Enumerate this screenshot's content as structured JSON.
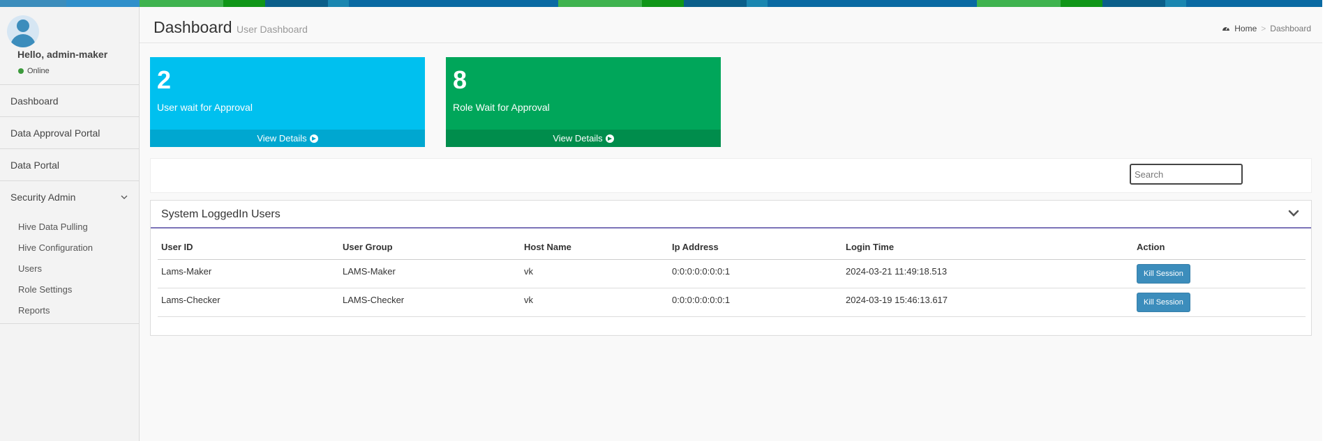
{
  "top_strip_colors": [
    "#3c8dbc",
    "#2f9ad0",
    "#3fb34f",
    "#109618",
    "#0b5f8a",
    "#1171a8",
    "#0b73a8",
    "#0a6aa3",
    "#3fb34f",
    "#109618",
    "#0b5f8a",
    "#1a86b0",
    "#0a6aa3",
    "#0b6aa3",
    "#3fb34f",
    "#109618",
    "#0b5f8a",
    "#1a86b0",
    "#0a6aa3"
  ],
  "user": {
    "greeting": "Hello, admin-maker",
    "status": "Online"
  },
  "sidebar": {
    "items": [
      {
        "label": "Dashboard"
      },
      {
        "label": "Data Approval Portal"
      },
      {
        "label": "Data Portal"
      },
      {
        "label": "Security Admin"
      }
    ],
    "submenu": [
      {
        "label": "Hive Data Pulling"
      },
      {
        "label": "Hive Configuration"
      },
      {
        "label": "Users"
      },
      {
        "label": "Role Settings"
      },
      {
        "label": "Reports"
      }
    ]
  },
  "header": {
    "title": "Dashboard",
    "subtitle": "User Dashboard",
    "breadcrumb_home": "Home",
    "breadcrumb_separator": ">",
    "breadcrumb_current": "Dashboard"
  },
  "boxes": [
    {
      "count": "2",
      "label": "User wait for Approval",
      "footer": "View Details",
      "color": "#00c0ef"
    },
    {
      "count": "8",
      "label": "Role Wait for Approval",
      "footer": "View Details",
      "color": "#00a65a"
    }
  ],
  "search": {
    "placeholder": "Search",
    "value": ""
  },
  "panel": {
    "title": "System LoggedIn Users",
    "columns": [
      "User ID",
      "User Group",
      "Host Name",
      "Ip Address",
      "Login Time",
      "Action"
    ],
    "rows": [
      {
        "user_id": "Lams-Maker",
        "user_group": "LAMS-Maker",
        "host": "vk",
        "ip": "0:0:0:0:0:0:0:1",
        "login_time": "2024-03-21 11:49:18.513",
        "action": "Kill Session"
      },
      {
        "user_id": "Lams-Checker",
        "user_group": "LAMS-Checker",
        "host": "vk",
        "ip": "0:0:0:0:0:0:0:1",
        "login_time": "2024-03-19 15:46:13.617",
        "action": "Kill Session"
      }
    ]
  }
}
